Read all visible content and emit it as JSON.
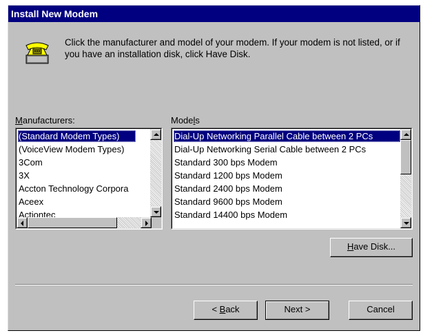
{
  "window": {
    "title": "Install New Modem"
  },
  "icon": "telephone-modem-icon",
  "instructions": "Click the manufacturer and model of your modem. If your modem is not listed, or if you have an installation disk, click Have Disk.",
  "manufacturers": {
    "label_prefix": "",
    "label_accel": "M",
    "label_rest": "anufacturers:",
    "items": [
      "(Standard Modem Types)",
      "(VoiceView Modem Types)",
      "3Com",
      "3X",
      "Accton Technology Corpora",
      "Aceex",
      "Actiontec"
    ],
    "selected_index": 0
  },
  "models": {
    "label_prefix": "Mode",
    "label_accel": "l",
    "label_rest": "s",
    "items": [
      "Dial-Up Networking Parallel Cable between 2 PCs",
      "Dial-Up Networking Serial Cable between 2 PCs",
      "Standard   300 bps Modem",
      "Standard  1200 bps Modem",
      "Standard  2400 bps Modem",
      "Standard  9600 bps Modem",
      "Standard 14400 bps Modem"
    ],
    "selected_index": 0
  },
  "buttons": {
    "have_disk": {
      "accel": "H",
      "rest": "ave Disk..."
    },
    "back": {
      "prefix": "< ",
      "accel": "B",
      "rest": "ack"
    },
    "next": "Next >",
    "cancel": "Cancel"
  },
  "colors": {
    "face": "#c0c0c0",
    "title": "#000080",
    "selection": "#000080"
  }
}
